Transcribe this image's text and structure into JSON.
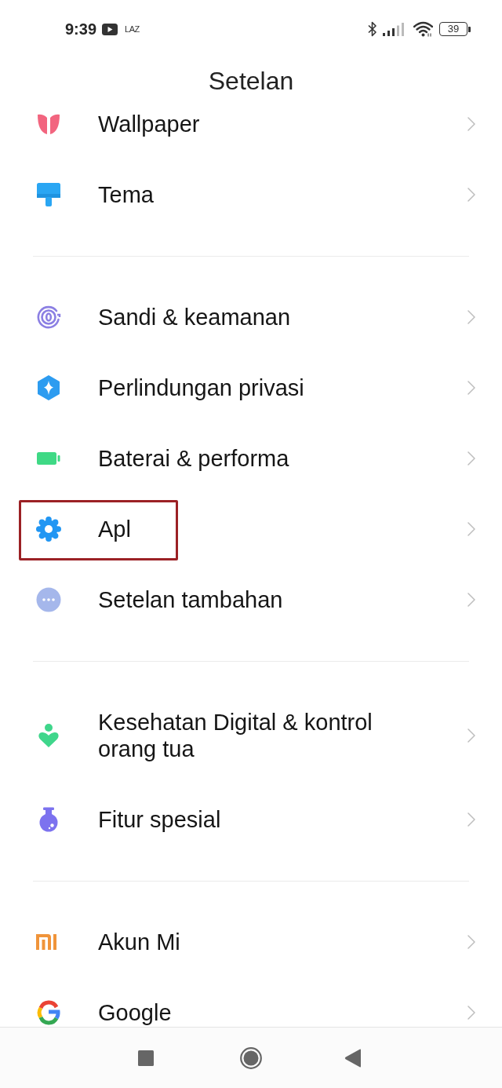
{
  "status_bar": {
    "time": "9:39",
    "notification_text": "LAZ",
    "battery": "39"
  },
  "title": "Setelan",
  "sections": [
    {
      "items": [
        {
          "label": "Wallpaper",
          "highlighted": false
        },
        {
          "label": "Tema",
          "highlighted": false
        }
      ]
    },
    {
      "items": [
        {
          "label": "Sandi & keamanan",
          "highlighted": false
        },
        {
          "label": "Perlindungan privasi",
          "highlighted": false
        },
        {
          "label": "Baterai & performa",
          "highlighted": false
        },
        {
          "label": "Apl",
          "highlighted": true
        },
        {
          "label": "Setelan tambahan",
          "highlighted": false
        }
      ]
    },
    {
      "items": [
        {
          "label": "Kesehatan Digital & kontrol orang tua",
          "highlighted": false
        },
        {
          "label": "Fitur spesial",
          "highlighted": false
        }
      ]
    },
    {
      "items": [
        {
          "label": "Akun Mi",
          "highlighted": false
        },
        {
          "label": "Google",
          "highlighted": false
        }
      ]
    }
  ]
}
